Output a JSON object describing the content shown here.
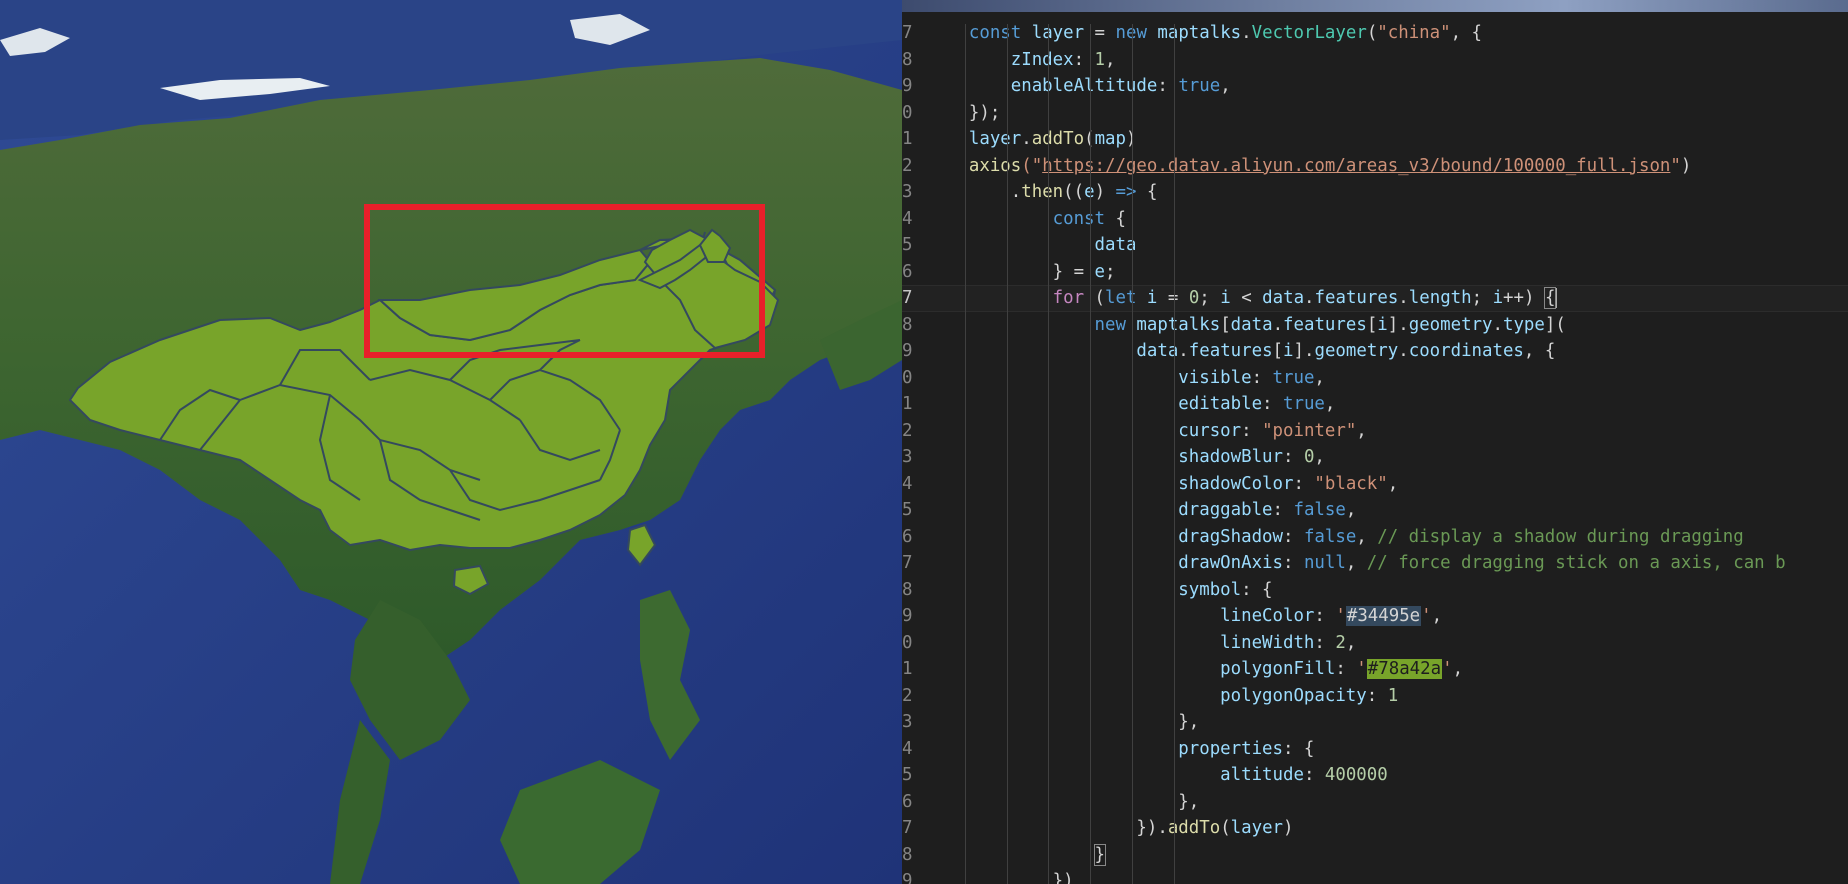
{
  "map": {
    "highlight_color": "#78a42a",
    "border_color": "#34495e",
    "selection_box_color": "#e8202a",
    "ocean_color": "#2d448f",
    "land_color": "#3f6a32"
  },
  "editor": {
    "current_line_index": 10,
    "lines": [
      {
        "num": "7",
        "tokens": [
          [
            "    ",
            "pun"
          ],
          [
            "const",
            "kw"
          ],
          [
            " layer ",
            "var"
          ],
          [
            "= ",
            "pun"
          ],
          [
            "new ",
            "kw"
          ],
          [
            "maptalks",
            "var"
          ],
          [
            ".",
            "pun"
          ],
          [
            "VectorLayer",
            "cls"
          ],
          [
            "(",
            "pun"
          ],
          [
            "\"china\"",
            "str"
          ],
          [
            ", {",
            "pun"
          ]
        ]
      },
      {
        "num": "8",
        "tokens": [
          [
            "        ",
            "pun"
          ],
          [
            "zIndex",
            "var"
          ],
          [
            ": ",
            "pun"
          ],
          [
            "1",
            "num"
          ],
          [
            ",",
            "pun"
          ]
        ]
      },
      {
        "num": "9",
        "tokens": [
          [
            "        ",
            "pun"
          ],
          [
            "enableAltitude",
            "var"
          ],
          [
            ": ",
            "pun"
          ],
          [
            "true",
            "kw"
          ],
          [
            ",",
            "pun"
          ]
        ]
      },
      {
        "num": "0",
        "tokens": [
          [
            "    ",
            "pun"
          ],
          [
            "});",
            "pun"
          ]
        ]
      },
      {
        "num": "1",
        "tokens": [
          [
            "    ",
            "pun"
          ],
          [
            "layer",
            "var"
          ],
          [
            ".",
            "pun"
          ],
          [
            "addTo",
            "fn"
          ],
          [
            "(",
            "pun"
          ],
          [
            "map",
            "var"
          ],
          [
            ")",
            "pun"
          ]
        ]
      },
      {
        "num": "2",
        "tokens": [
          [
            "    ",
            "pun"
          ],
          [
            "axios",
            "fn"
          ],
          [
            "(\"",
            "str"
          ],
          [
            "https://geo.datav.aliyun.com/areas_v3/bound/100000_full.json",
            "url"
          ],
          [
            "\"",
            "str"
          ],
          [
            ")",
            "pun"
          ]
        ]
      },
      {
        "num": "3",
        "tokens": [
          [
            "        ",
            "pun"
          ],
          [
            ".",
            "pun"
          ],
          [
            "then",
            "fn"
          ],
          [
            "((",
            "pun"
          ],
          [
            "e",
            "var"
          ],
          [
            ") ",
            "pun"
          ],
          [
            "=>",
            "kw"
          ],
          [
            " {",
            "pun"
          ]
        ]
      },
      {
        "num": "4",
        "tokens": [
          [
            "            ",
            "pun"
          ],
          [
            "const",
            "kw"
          ],
          [
            " {",
            "pun"
          ]
        ]
      },
      {
        "num": "5",
        "tokens": [
          [
            "                ",
            "pun"
          ],
          [
            "data",
            "var"
          ]
        ]
      },
      {
        "num": "6",
        "tokens": [
          [
            "            ",
            "pun"
          ],
          [
            "} = ",
            "pun"
          ],
          [
            "e",
            "var"
          ],
          [
            ";",
            "pun"
          ]
        ]
      },
      {
        "num": "7",
        "tokens": [
          [
            "            ",
            "pun"
          ],
          [
            "for",
            "ctl"
          ],
          [
            " (",
            "pun"
          ],
          [
            "let",
            "kw"
          ],
          [
            " i ",
            "var"
          ],
          [
            "= ",
            "pun"
          ],
          [
            "0",
            "num"
          ],
          [
            "; ",
            "pun"
          ],
          [
            "i",
            "var"
          ],
          [
            " < ",
            "pun"
          ],
          [
            "data",
            "var"
          ],
          [
            ".",
            "pun"
          ],
          [
            "features",
            "var"
          ],
          [
            ".",
            "pun"
          ],
          [
            "length",
            "var"
          ],
          [
            "; ",
            "pun"
          ],
          [
            "i",
            "var"
          ],
          [
            "++) ",
            "pun"
          ],
          [
            "{",
            "brk"
          ]
        ]
      },
      {
        "num": "8",
        "tokens": [
          [
            "                ",
            "pun"
          ],
          [
            "new ",
            "kw"
          ],
          [
            "maptalks",
            "var"
          ],
          [
            "[",
            "pun"
          ],
          [
            "data",
            "var"
          ],
          [
            ".",
            "pun"
          ],
          [
            "features",
            "var"
          ],
          [
            "[",
            "pun"
          ],
          [
            "i",
            "var"
          ],
          [
            "].",
            "pun"
          ],
          [
            "geometry",
            "var"
          ],
          [
            ".",
            "pun"
          ],
          [
            "type",
            "var"
          ],
          [
            "](",
            "pun"
          ]
        ]
      },
      {
        "num": "9",
        "tokens": [
          [
            "                    ",
            "pun"
          ],
          [
            "data",
            "var"
          ],
          [
            ".",
            "pun"
          ],
          [
            "features",
            "var"
          ],
          [
            "[",
            "pun"
          ],
          [
            "i",
            "var"
          ],
          [
            "].",
            "pun"
          ],
          [
            "geometry",
            "var"
          ],
          [
            ".",
            "pun"
          ],
          [
            "coordinates",
            "var"
          ],
          [
            ", {",
            "pun"
          ]
        ]
      },
      {
        "num": "0",
        "tokens": [
          [
            "                        ",
            "pun"
          ],
          [
            "visible",
            "var"
          ],
          [
            ": ",
            "pun"
          ],
          [
            "true",
            "kw"
          ],
          [
            ",",
            "pun"
          ]
        ]
      },
      {
        "num": "1",
        "tokens": [
          [
            "                        ",
            "pun"
          ],
          [
            "editable",
            "var"
          ],
          [
            ": ",
            "pun"
          ],
          [
            "true",
            "kw"
          ],
          [
            ",",
            "pun"
          ]
        ]
      },
      {
        "num": "2",
        "tokens": [
          [
            "                        ",
            "pun"
          ],
          [
            "cursor",
            "var"
          ],
          [
            ": ",
            "pun"
          ],
          [
            "\"pointer\"",
            "str"
          ],
          [
            ",",
            "pun"
          ]
        ]
      },
      {
        "num": "3",
        "tokens": [
          [
            "                        ",
            "pun"
          ],
          [
            "shadowBlur",
            "var"
          ],
          [
            ": ",
            "pun"
          ],
          [
            "0",
            "num"
          ],
          [
            ",",
            "pun"
          ]
        ]
      },
      {
        "num": "4",
        "tokens": [
          [
            "                        ",
            "pun"
          ],
          [
            "shadowColor",
            "var"
          ],
          [
            ": ",
            "pun"
          ],
          [
            "\"black\"",
            "str"
          ],
          [
            ",",
            "pun"
          ]
        ]
      },
      {
        "num": "5",
        "tokens": [
          [
            "                        ",
            "pun"
          ],
          [
            "draggable",
            "var"
          ],
          [
            ": ",
            "pun"
          ],
          [
            "false",
            "kw"
          ],
          [
            ",",
            "pun"
          ]
        ]
      },
      {
        "num": "6",
        "tokens": [
          [
            "                        ",
            "pun"
          ],
          [
            "dragShadow",
            "var"
          ],
          [
            ": ",
            "pun"
          ],
          [
            "false",
            "kw"
          ],
          [
            ", ",
            "pun"
          ],
          [
            "// display a shadow during dragging",
            "cmt"
          ]
        ]
      },
      {
        "num": "7",
        "tokens": [
          [
            "                        ",
            "pun"
          ],
          [
            "drawOnAxis",
            "var"
          ],
          [
            ": ",
            "pun"
          ],
          [
            "null",
            "kw"
          ],
          [
            ", ",
            "pun"
          ],
          [
            "// force dragging stick on a axis, can b",
            "cmt"
          ]
        ]
      },
      {
        "num": "8",
        "tokens": [
          [
            "                        ",
            "pun"
          ],
          [
            "symbol",
            "var"
          ],
          [
            ": {",
            "pun"
          ]
        ]
      },
      {
        "num": "9",
        "tokens": [
          [
            "                            ",
            "pun"
          ],
          [
            "lineColor",
            "var"
          ],
          [
            ": ",
            "pun"
          ],
          [
            "'",
            "str"
          ],
          [
            "#34495e",
            "sw1"
          ],
          [
            "'",
            "str"
          ],
          [
            ",",
            "pun"
          ]
        ]
      },
      {
        "num": "0",
        "tokens": [
          [
            "                            ",
            "pun"
          ],
          [
            "lineWidth",
            "var"
          ],
          [
            ": ",
            "pun"
          ],
          [
            "2",
            "num"
          ],
          [
            ",",
            "pun"
          ]
        ]
      },
      {
        "num": "1",
        "tokens": [
          [
            "                            ",
            "pun"
          ],
          [
            "polygonFill",
            "var"
          ],
          [
            ": ",
            "pun"
          ],
          [
            "'",
            "str"
          ],
          [
            "#78a42a",
            "sw2"
          ],
          [
            "'",
            "str"
          ],
          [
            ",",
            "pun"
          ]
        ]
      },
      {
        "num": "2",
        "tokens": [
          [
            "                            ",
            "pun"
          ],
          [
            "polygonOpacity",
            "var"
          ],
          [
            ": ",
            "pun"
          ],
          [
            "1",
            "num"
          ]
        ]
      },
      {
        "num": "3",
        "tokens": [
          [
            "                        ",
            "pun"
          ],
          [
            "},",
            "pun"
          ]
        ]
      },
      {
        "num": "4",
        "tokens": [
          [
            "                        ",
            "pun"
          ],
          [
            "properties",
            "var"
          ],
          [
            ": {",
            "pun"
          ]
        ]
      },
      {
        "num": "5",
        "tokens": [
          [
            "                            ",
            "pun"
          ],
          [
            "altitude",
            "var"
          ],
          [
            ": ",
            "pun"
          ],
          [
            "400000",
            "num"
          ]
        ]
      },
      {
        "num": "6",
        "tokens": [
          [
            "                        ",
            "pun"
          ],
          [
            "},",
            "pun"
          ]
        ]
      },
      {
        "num": "7",
        "tokens": [
          [
            "                    ",
            "pun"
          ],
          [
            "}).",
            "pun"
          ],
          [
            "addTo",
            "fn"
          ],
          [
            "(",
            "pun"
          ],
          [
            "layer",
            "var"
          ],
          [
            ")",
            "pun"
          ]
        ]
      },
      {
        "num": "8",
        "tokens": [
          [
            "                ",
            "pun"
          ],
          [
            "}",
            "brk"
          ]
        ]
      },
      {
        "num": "9",
        "tokens": [
          [
            "            ",
            "pun"
          ],
          [
            "})",
            "pun"
          ]
        ]
      }
    ]
  }
}
